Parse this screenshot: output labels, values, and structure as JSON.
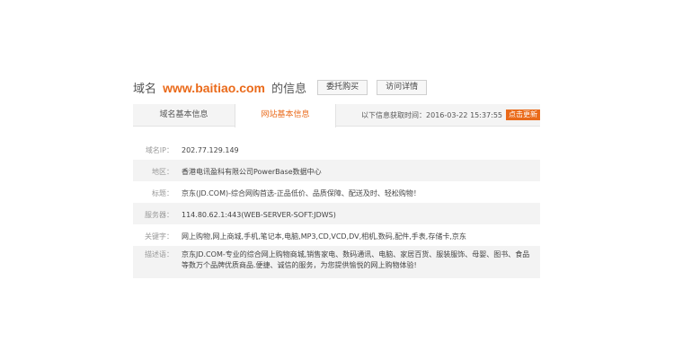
{
  "header": {
    "prefix": "域名",
    "domain": "www.baitiao.com",
    "suffix": "的信息",
    "buttons": [
      "委托购买",
      "访问详情"
    ]
  },
  "tabs": [
    {
      "label": "域名基本信息",
      "active": false
    },
    {
      "label": "网站基本信息",
      "active": true
    }
  ],
  "fetch_info": {
    "text": "以下信息获取时间：2016-03-22 15:37:55",
    "refresh_label": "点击更新"
  },
  "rows": [
    {
      "label": "域名IP：",
      "value": "202.77.129.149"
    },
    {
      "label": "地区：",
      "value": "香港电讯盈科有限公司PowerBase数据中心"
    },
    {
      "label": "标题：",
      "value": "京东(JD.COM)-综合网购首选-正品低价、品质保障、配送及时、轻松购物！"
    },
    {
      "label": "服务器：",
      "value": "114.80.62.1:443(WEB-SERVER-SOFT:JDWS)"
    },
    {
      "label": "关键字：",
      "value": "网上购物,网上商城,手机,笔记本,电脑,MP3,CD,VCD,DV,相机,数码,配件,手表,存储卡,京东"
    },
    {
      "label": "描述语：",
      "value": "京东JD.COM-专业的综合网上购物商城,销售家电、数码通讯、电脑、家居百货、服装服饰、母婴、图书、食品等数万个品牌优质商品.便捷、诚信的服务，为您提供愉悦的网上购物体验!"
    }
  ],
  "colors": {
    "accent": "#ea6a1a",
    "shade": "#f3f3f3"
  }
}
